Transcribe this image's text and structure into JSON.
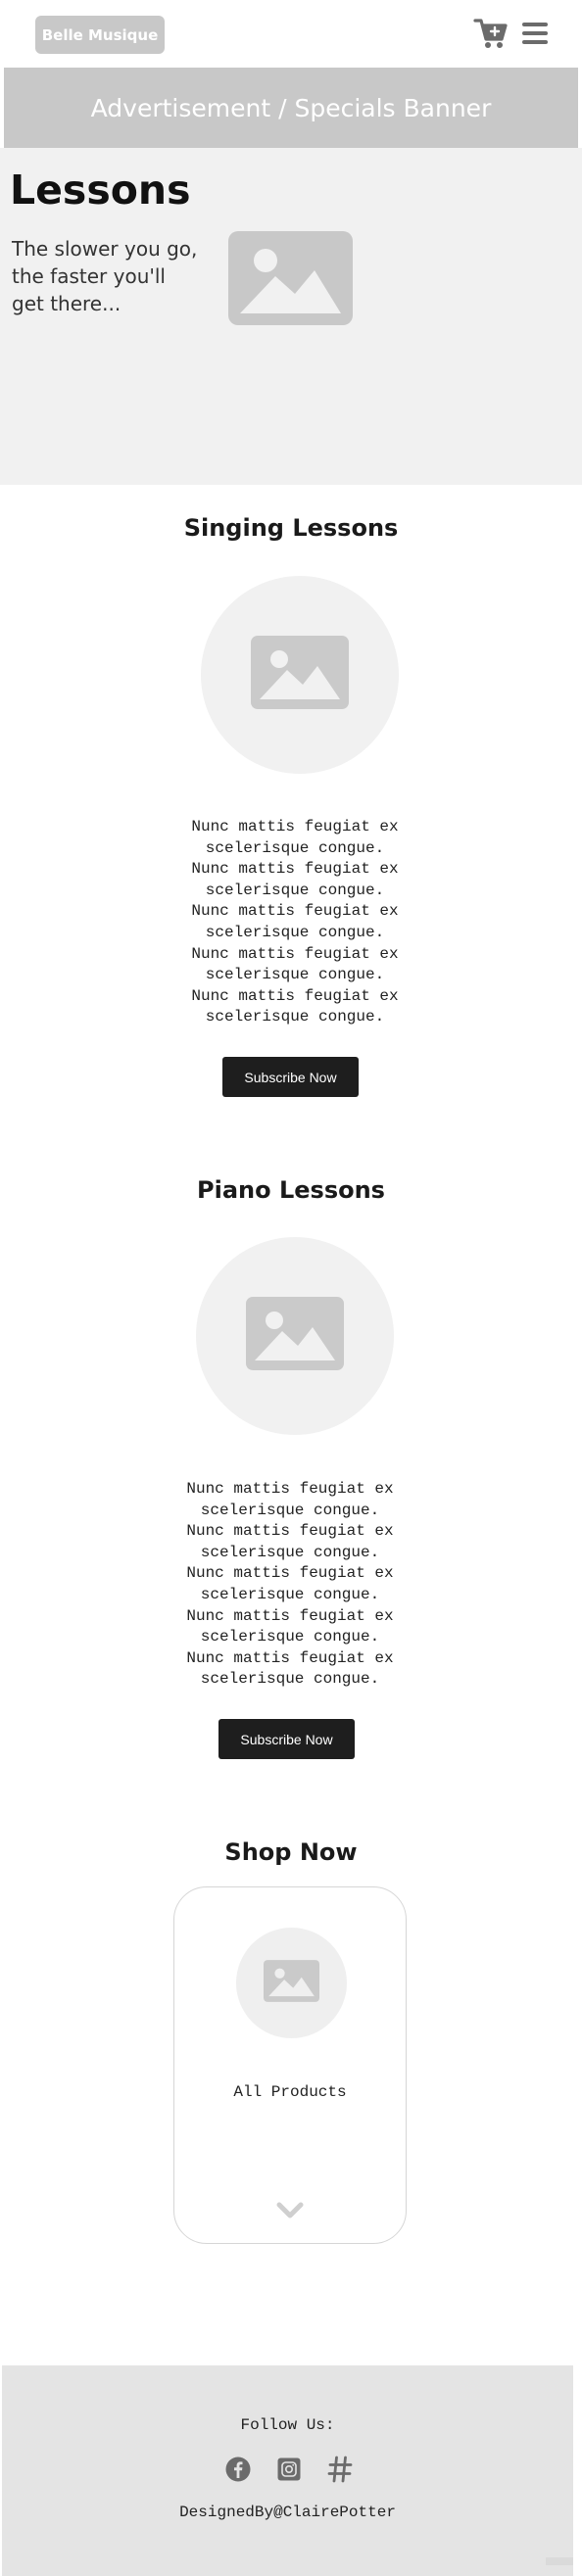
{
  "header": {
    "logo_label": "Belle Musique",
    "cart_icon": "cart-plus-icon",
    "menu_icon": "hamburger-menu-icon"
  },
  "banner": {
    "text": "Advertisement / Specials Banner"
  },
  "hero": {
    "title": "Lessons",
    "tagline": "The slower you go, the faster you'll get there...",
    "image_icon": "image-placeholder-icon"
  },
  "sections": [
    {
      "title": "Singing Lessons",
      "description_lines": [
        "Nunc mattis feugiat ex",
        "scelerisque congue.",
        "Nunc mattis feugiat ex",
        "scelerisque congue.",
        "Nunc mattis feugiat ex",
        "scelerisque congue.",
        "Nunc mattis feugiat ex",
        "scelerisque congue.",
        "Nunc mattis feugiat ex",
        "scelerisque congue."
      ],
      "button_label": "Subscribe Now"
    },
    {
      "title": "Piano Lessons",
      "description_lines": [
        "Nunc mattis feugiat ex",
        "scelerisque congue.",
        "Nunc mattis feugiat ex",
        "scelerisque congue.",
        "Nunc mattis feugiat ex",
        "scelerisque congue.",
        "Nunc mattis feugiat ex",
        "scelerisque congue.",
        "Nunc mattis feugiat ex",
        "scelerisque congue."
      ],
      "button_label": "Subscribe Now"
    }
  ],
  "shop": {
    "title": "Shop Now",
    "card_label": "All Products",
    "expand_icon": "chevron-down-icon"
  },
  "footer": {
    "follow_label": "Follow Us:",
    "social_icons": [
      "facebook-icon",
      "instagram-icon",
      "hashtag-icon"
    ],
    "designer_credit": "DesignedBy@ClairePotter"
  },
  "colors": {
    "placeholder_gray": "#c8c8c8",
    "hero_background": "#f1f1f1",
    "button_dark": "#1e1e1e",
    "footer_background": "#e4e4e4"
  }
}
